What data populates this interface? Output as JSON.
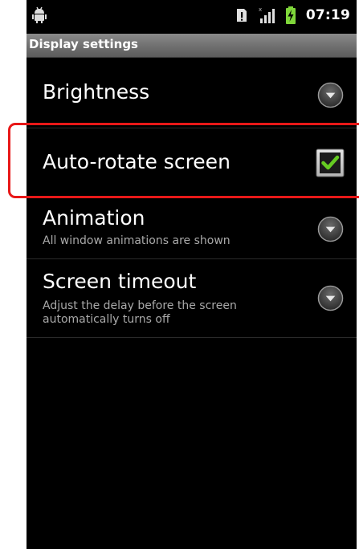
{
  "status_bar": {
    "time": "07:19",
    "left_icon": "android-debug-icon",
    "right_icons": [
      "sd-card-icon",
      "signal-icon",
      "battery-charging-icon"
    ]
  },
  "title_bar": {
    "title": "Display settings"
  },
  "settings": {
    "brightness": {
      "title": "Brightness",
      "icon": "chevron-down-circle-icon"
    },
    "auto_rotate": {
      "title": "Auto-rotate screen",
      "checked": true
    },
    "animation": {
      "title": "Animation",
      "summary": "All window animations are shown",
      "icon": "chevron-down-circle-icon"
    },
    "screen_timeout": {
      "title": "Screen timeout",
      "summary": "Adjust the delay before the screen automatically turns off",
      "icon": "chevron-down-circle-icon"
    }
  },
  "colors": {
    "background": "#000000",
    "highlight": "#e81818",
    "check": "#66cc22",
    "summary_text": "#a9a9a9"
  }
}
